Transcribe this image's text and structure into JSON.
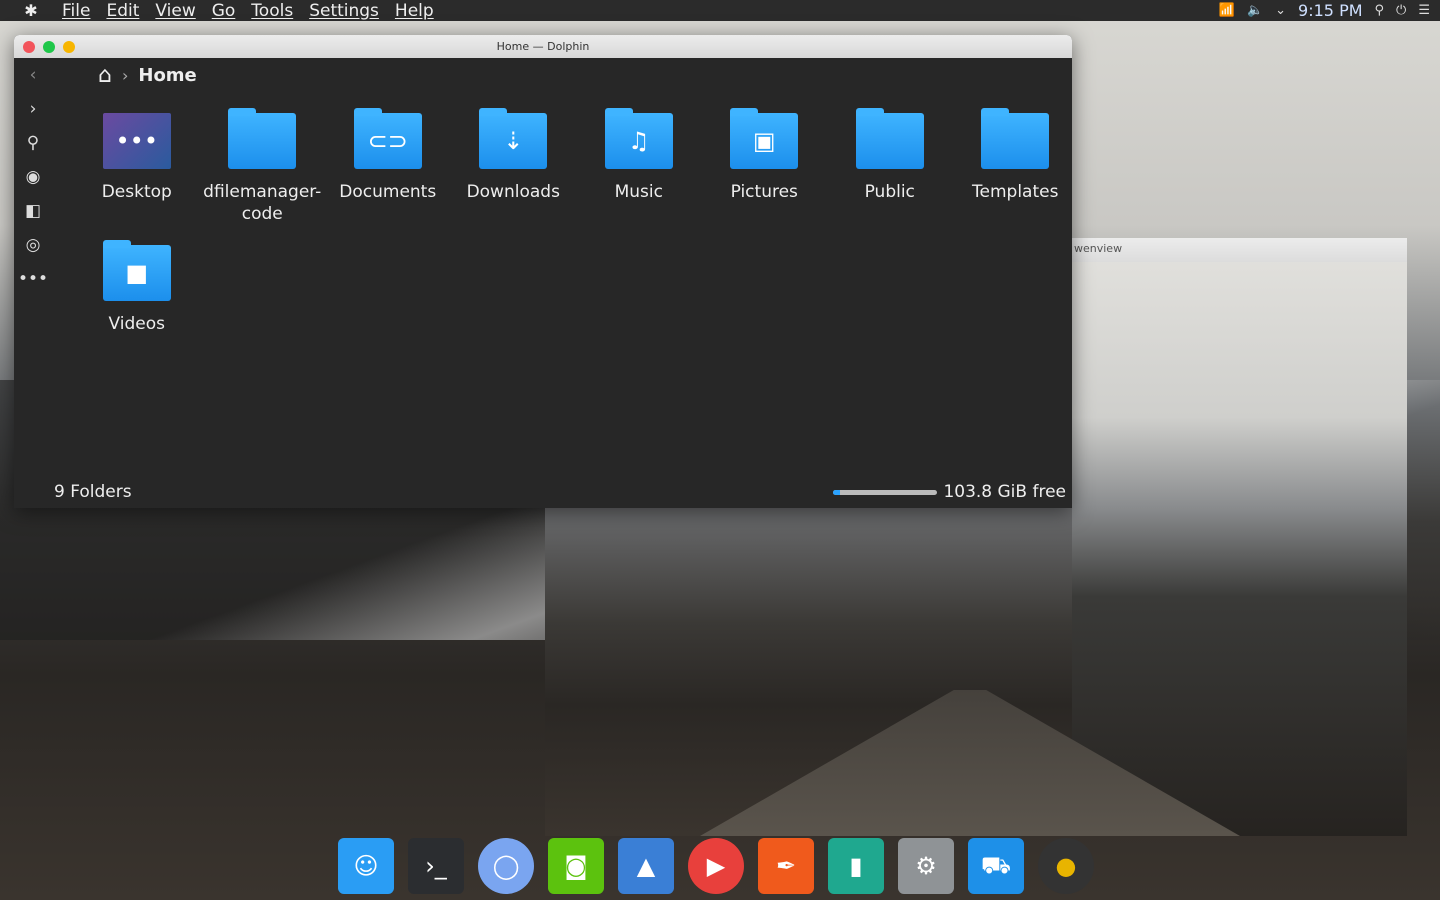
{
  "topbar": {
    "menus": [
      "File",
      "Edit",
      "View",
      "Go",
      "Tools",
      "Settings",
      "Help"
    ],
    "clock": "9:15 PM",
    "tray_icons": [
      "wifi-icon",
      "volume-icon",
      "chevron-down-icon",
      "search-icon",
      "power-icon",
      "menu-icon"
    ]
  },
  "dolphin": {
    "title": "Home — Dolphin",
    "breadcrumb": "Home",
    "status": "9 Folders",
    "free": "103.8 GiB free",
    "free_used_fraction": 0.06,
    "folders": [
      {
        "name": "Desktop",
        "icon": "desktop"
      },
      {
        "name": "dfilemanager-code",
        "icon": "folder"
      },
      {
        "name": "Documents",
        "icon": "documents"
      },
      {
        "name": "Downloads",
        "icon": "downloads"
      },
      {
        "name": "Music",
        "icon": "music"
      },
      {
        "name": "Pictures",
        "icon": "pictures"
      },
      {
        "name": "Public",
        "icon": "folder"
      },
      {
        "name": "Templates",
        "icon": "folder"
      },
      {
        "name": "Videos",
        "icon": "videos"
      }
    ]
  },
  "gwenview": {
    "title": "wenview"
  },
  "dock": [
    "files-icon",
    "terminal-icon",
    "chromium-icon",
    "camera-icon",
    "image-viewer-icon",
    "youtube-icon",
    "writer-icon",
    "charts-icon",
    "settings-icon",
    "store-icon",
    "music-player-icon"
  ],
  "colors": {
    "accent": "#2ba3ff",
    "close": "#f2545b",
    "min": "#1fc74a",
    "max": "#f7b500"
  }
}
